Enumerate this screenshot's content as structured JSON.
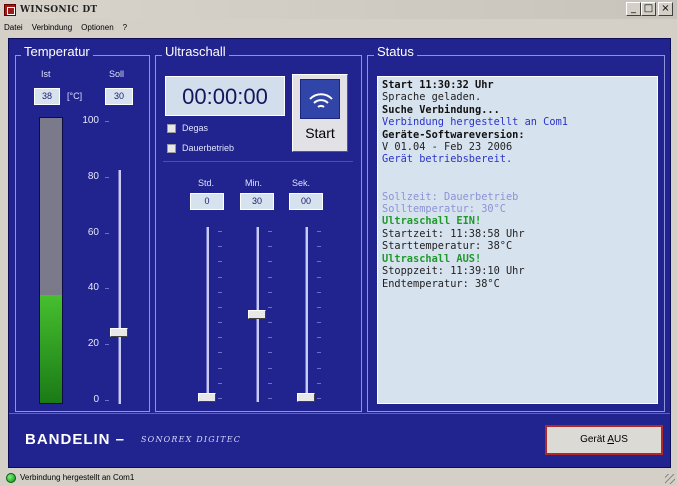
{
  "window": {
    "title": "WINSONIC DT",
    "controls": [
      "_",
      "□",
      "×"
    ]
  },
  "menu": [
    {
      "label": "Datei"
    },
    {
      "label": "Verbindung"
    },
    {
      "label": "Optionen"
    },
    {
      "label": "?"
    }
  ],
  "temperatur": {
    "title": "Temperatur",
    "ist_label": "Ist",
    "soll_label": "Soll",
    "ist_value": "38",
    "unit": "[°C]",
    "soll_value": "30",
    "scale": [
      "100",
      "80",
      "60",
      "40",
      "20",
      "0"
    ],
    "ist_level_fraction": 0.38,
    "soll_slider_fraction": 0.3
  },
  "ultraschall": {
    "title": "Ultraschall",
    "timer": "00:00:00",
    "degas_label": "Degas",
    "dauerbetrieb_label": "Dauerbetrieb",
    "start_label": "Start",
    "std_label": "Std.",
    "min_label": "Min.",
    "sek_label": "Sek.",
    "std_value": "0",
    "min_value": "30",
    "sek_value": "00",
    "std_slider_fraction": 0.0,
    "min_slider_fraction": 0.5,
    "sek_slider_fraction": 0.0
  },
  "status": {
    "title": "Status",
    "lines": [
      {
        "text": "Start 11:30:32 Uhr",
        "style": "bold"
      },
      {
        "text": "Sprache geladen.",
        "style": "normal"
      },
      {
        "text": "Suche Verbindung...",
        "style": "bold"
      },
      {
        "text": "Verbindung hergestellt an Com1",
        "style": "blue"
      },
      {
        "text": "Geräte-Softwareversion:",
        "style": "bold"
      },
      {
        "text": "V 01.04 - Feb 23 2006",
        "style": "normal"
      },
      {
        "text": "Gerät betriebsbereit.",
        "style": "blue"
      },
      {
        "text": "",
        "style": "normal"
      },
      {
        "text": "",
        "style": "normal"
      },
      {
        "text": "Sollzeit: Dauerbetrieb",
        "style": "faint"
      },
      {
        "text": "Solltemperatur: 30°C",
        "style": "faint"
      },
      {
        "text": "Ultraschall EIN!",
        "style": "green"
      },
      {
        "text": "Startzeit: 11:38:58 Uhr",
        "style": "normal"
      },
      {
        "text": "Starttemperatur: 38°C",
        "style": "normal"
      },
      {
        "text": "Ultraschall AUS!",
        "style": "green"
      },
      {
        "text": "Stoppzeit: 11:39:10 Uhr",
        "style": "normal"
      },
      {
        "text": "Endtemperatur: 38°C",
        "style": "normal"
      }
    ]
  },
  "footer": {
    "brand": "BANDELIN –",
    "brand_sub": "SONOREX DIGITEC",
    "geraet_prefix": "Gerät ",
    "geraet_underline": "A",
    "geraet_suffix": "US"
  },
  "statusbar": {
    "text": "Verbindung hergestellt an Com1"
  },
  "colors": {
    "panel_bg": "#21238e",
    "display_bg": "#d7e2ef",
    "green_fill": "#2fa523",
    "red_border": "#b02828"
  }
}
